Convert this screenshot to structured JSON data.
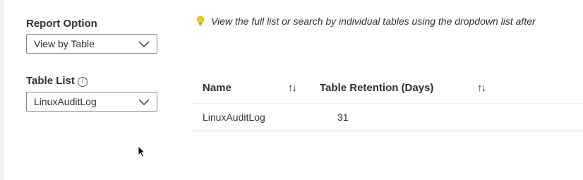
{
  "report_option": {
    "label": "Report Option",
    "selected": "View by Table"
  },
  "table_list": {
    "label": "Table List",
    "info_icon": "info-icon",
    "selected": "LinuxAuditLog"
  },
  "hint": {
    "icon": "lightbulb-icon",
    "text": "View the full list or search by individual tables using the dropdown list after"
  },
  "table": {
    "columns": [
      {
        "label": "Name",
        "sort_icon": "↑↓"
      },
      {
        "label": "Table Retention (Days)",
        "sort_icon": "↑↓"
      }
    ],
    "rows": [
      {
        "name": "LinuxAuditLog",
        "retention": "31"
      }
    ]
  },
  "colors": {
    "border": "#8a8886",
    "text": "#323130",
    "bulb": "#f2c811"
  }
}
